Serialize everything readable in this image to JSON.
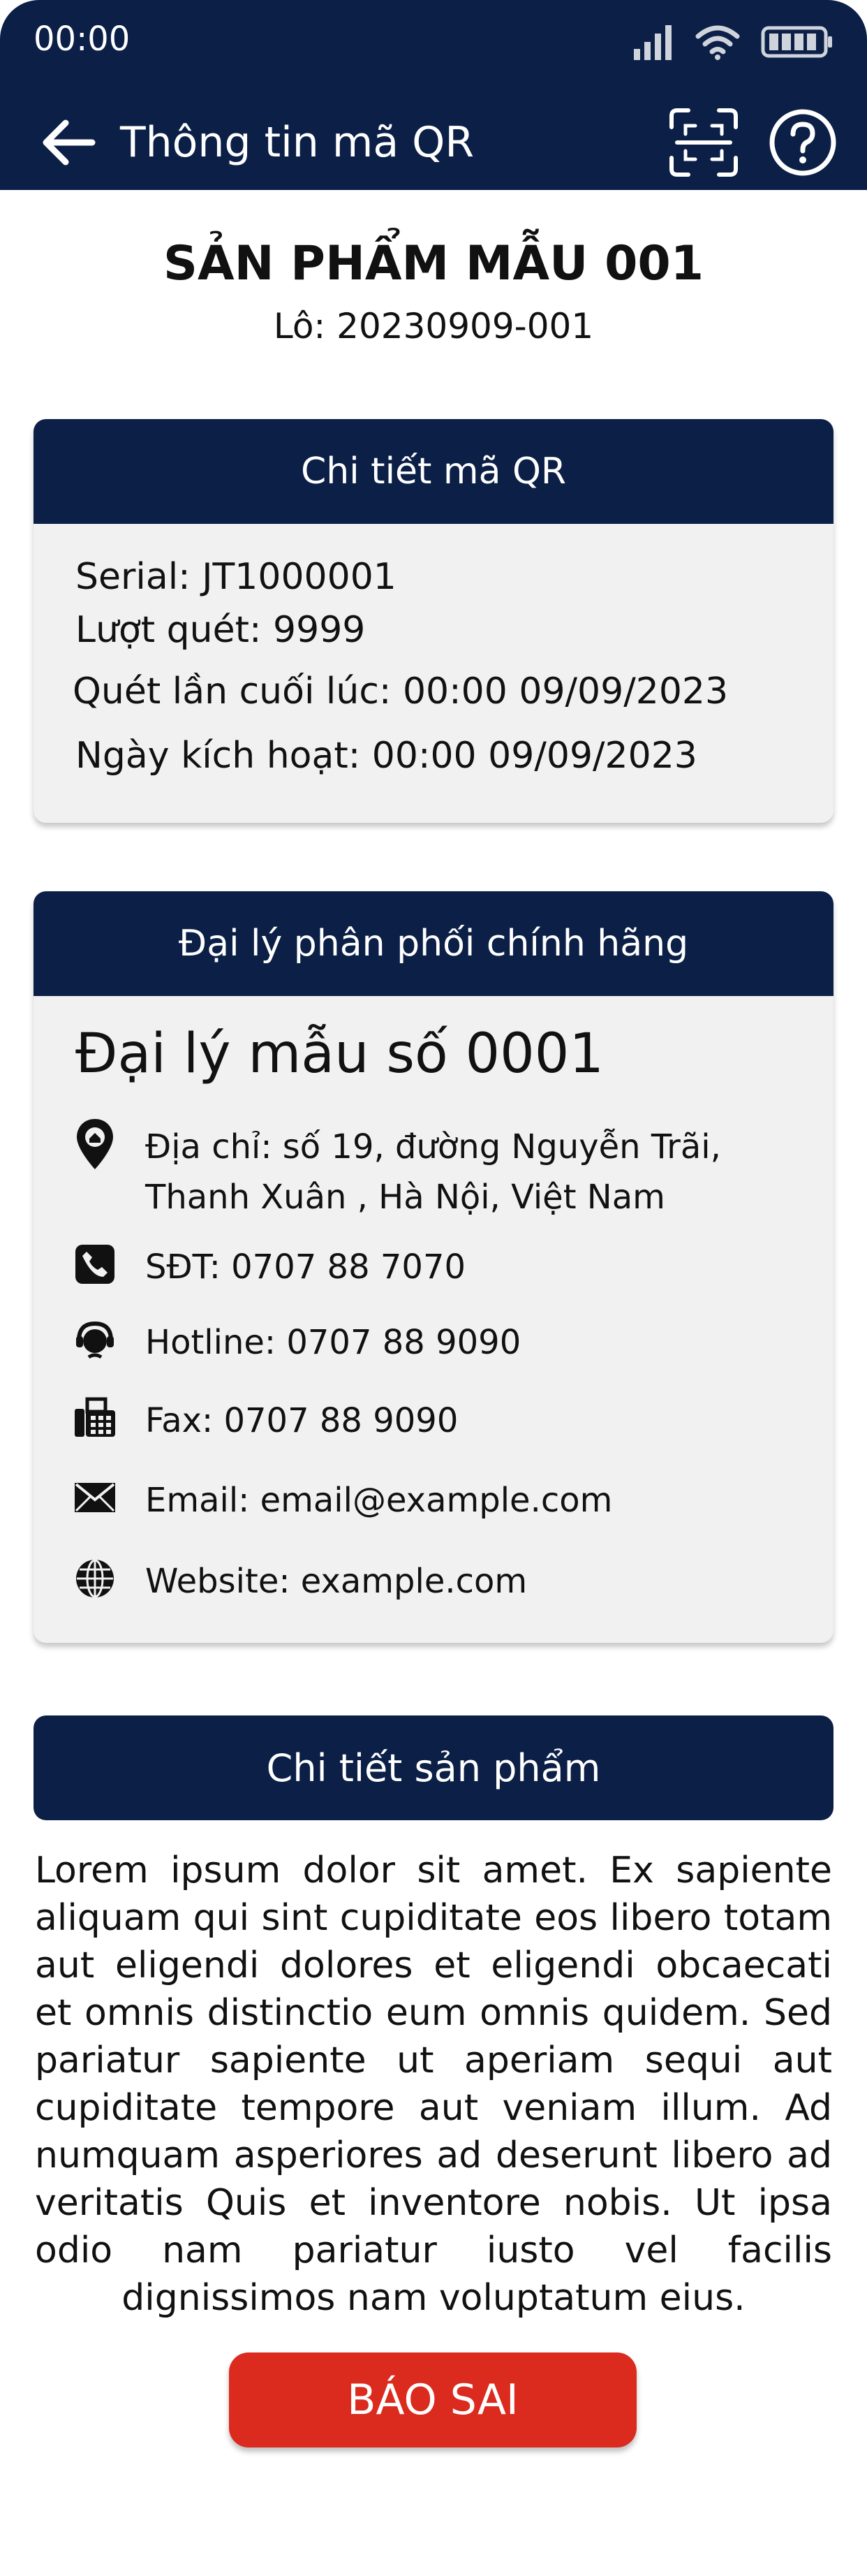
{
  "status_bar": {
    "time": "00:00"
  },
  "header": {
    "title": "Thông tin mã QR",
    "icons": [
      "arrow-left-icon",
      "qr-scan-icon",
      "help-icon"
    ]
  },
  "product": {
    "name": "SẢN PHẨM MẪU 001",
    "lot": "Lô: 20230909-001"
  },
  "qr_details": {
    "heading": "Chi tiết mã QR",
    "serial": "Serial: JT1000001",
    "scan_count": "Lượt quét: 9999",
    "last_scan": "Quét lần cuối lúc: 00:00 09/09/2023",
    "activation": "Ngày kích hoạt: 00:00 09/09/2023"
  },
  "dealer": {
    "heading": "Đại lý phân phối chính hãng",
    "name": "Đại lý mẫu số 0001",
    "address": "Địa chỉ: số 19, đường Nguyễn Trãi, Thanh Xuân , Hà Nội, Việt Nam",
    "phone": "SĐT: 0707 88 7070",
    "hotline": "Hotline: 0707 88 9090",
    "fax": "Fax: 0707 88 9090",
    "email": "Email: email@example.com",
    "website": "Website: example.com"
  },
  "product_details": {
    "heading": "Chi tiết sản phẩm",
    "description": "Lorem ipsum dolor sit amet. Ex sapiente aliquam qui sint cupiditate eos libero totam aut eligendi dolores et eligendi obcaecati et omnis distinctio eum omnis quidem. Sed pariatur sapiente ut aperiam sequi aut cupiditate tempore aut veniam illum. Ad numquam asperiores ad deserunt libero ad veritatis Quis et inventore nobis. Ut ipsa odio nam pariatur iusto vel facilis dignissimos nam voluptatum eius."
  },
  "report_button": {
    "label": "BÁO SAI"
  },
  "colors": {
    "header_bg": "#0b1f47",
    "card_bg": "#f1f1f1",
    "report_button": "#db2a1e"
  }
}
